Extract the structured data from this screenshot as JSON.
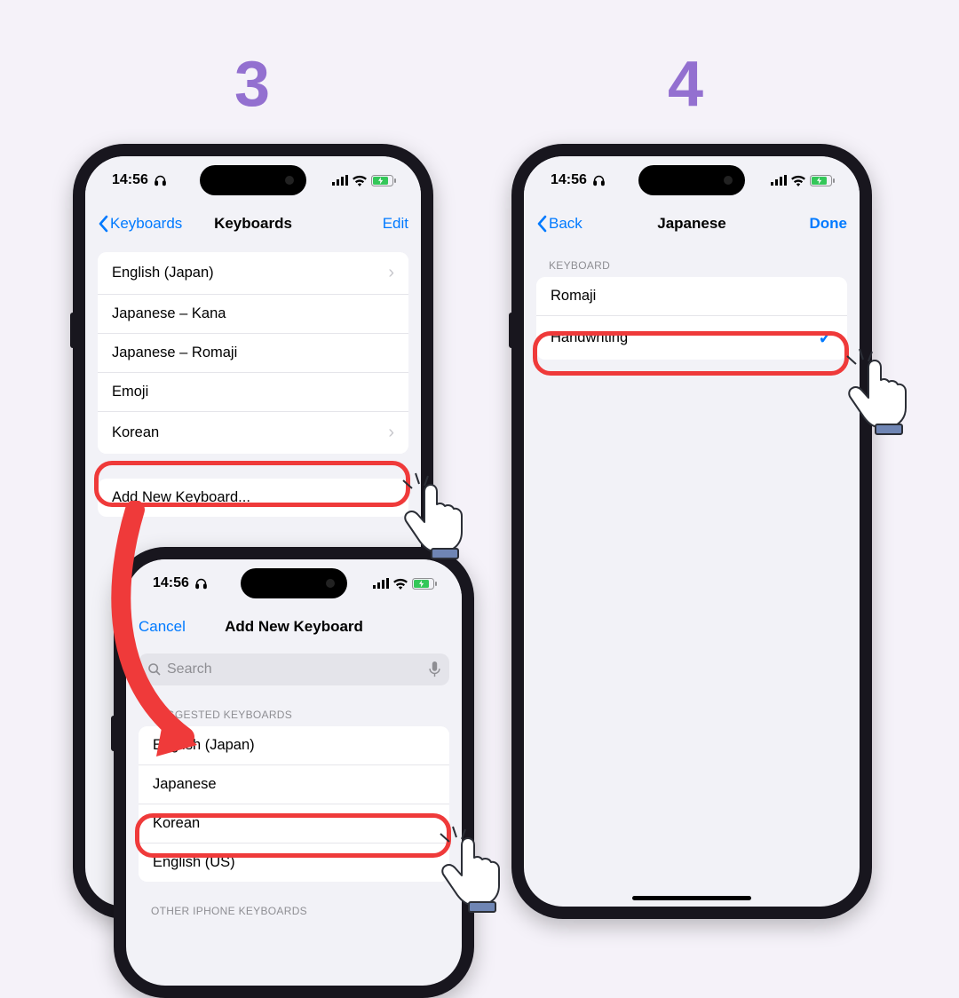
{
  "steps": {
    "s3": "3",
    "s4": "4"
  },
  "status": {
    "time": "14:56"
  },
  "phoneA": {
    "nav": {
      "back": "Keyboards",
      "title": "Keyboards",
      "right": "Edit"
    },
    "rows": {
      "r0": "English (Japan)",
      "r1": "Japanese – Kana",
      "r2": "Japanese – Romaji",
      "r3": "Emoji",
      "r4": "Korean"
    },
    "add": "Add New Keyboard..."
  },
  "phoneB": {
    "nav": {
      "left": "Cancel",
      "title": "Add New Keyboard"
    },
    "search_placeholder": "Search",
    "suggested_header": "SUGGESTED KEYBOARDS",
    "suggested": {
      "r0": "English (Japan)",
      "r1": "Japanese",
      "r2": "Korean",
      "r3": "English (US)"
    },
    "other_header": "OTHER IPHONE KEYBOARDS"
  },
  "phoneC": {
    "nav": {
      "back": "Back",
      "title": "Japanese",
      "right": "Done"
    },
    "section": "KEYBOARD",
    "rows": {
      "r0": "Romaji",
      "r1": "Handwriting"
    }
  }
}
